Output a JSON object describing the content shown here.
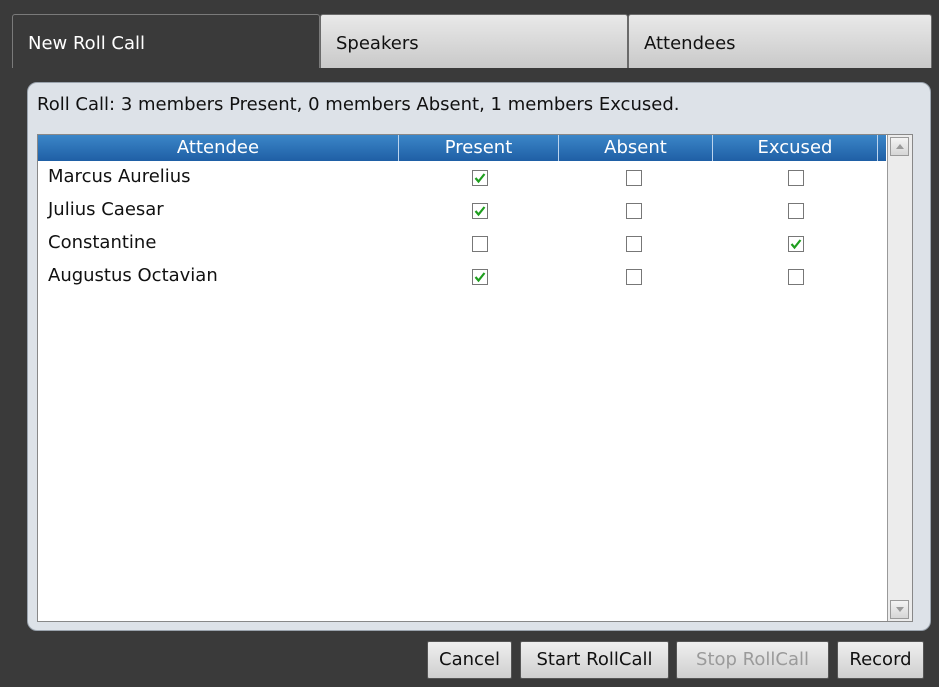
{
  "tabs": [
    {
      "label": "New Roll Call",
      "active": true
    },
    {
      "label": "Speakers",
      "active": false
    },
    {
      "label": "Attendees",
      "active": false
    }
  ],
  "summary": "Roll Call: 3 members Present, 0 members Absent, 1 members Excused.",
  "grid": {
    "columns": [
      "Attendee",
      "Present",
      "Absent",
      "Excused"
    ],
    "rows": [
      {
        "name": "Marcus Aurelius",
        "present": true,
        "absent": false,
        "excused": false
      },
      {
        "name": "Julius Caesar",
        "present": true,
        "absent": false,
        "excused": false
      },
      {
        "name": "Constantine",
        "present": false,
        "absent": false,
        "excused": true
      },
      {
        "name": "Augustus Octavian",
        "present": true,
        "absent": false,
        "excused": false
      }
    ]
  },
  "buttons": {
    "cancel": "Cancel",
    "start": "Start RollCall",
    "stop": "Stop RollCall",
    "record": "Record"
  },
  "buttons_state": {
    "stop_enabled": false
  },
  "colors": {
    "header_blue": "#2a6fb4",
    "check_green": "#1e9e1e",
    "panel": "#dde2e8"
  },
  "icons": {
    "check": "check-icon",
    "scroll_up": "scroll-up-arrow-icon",
    "scroll_down": "scroll-down-arrow-icon"
  }
}
